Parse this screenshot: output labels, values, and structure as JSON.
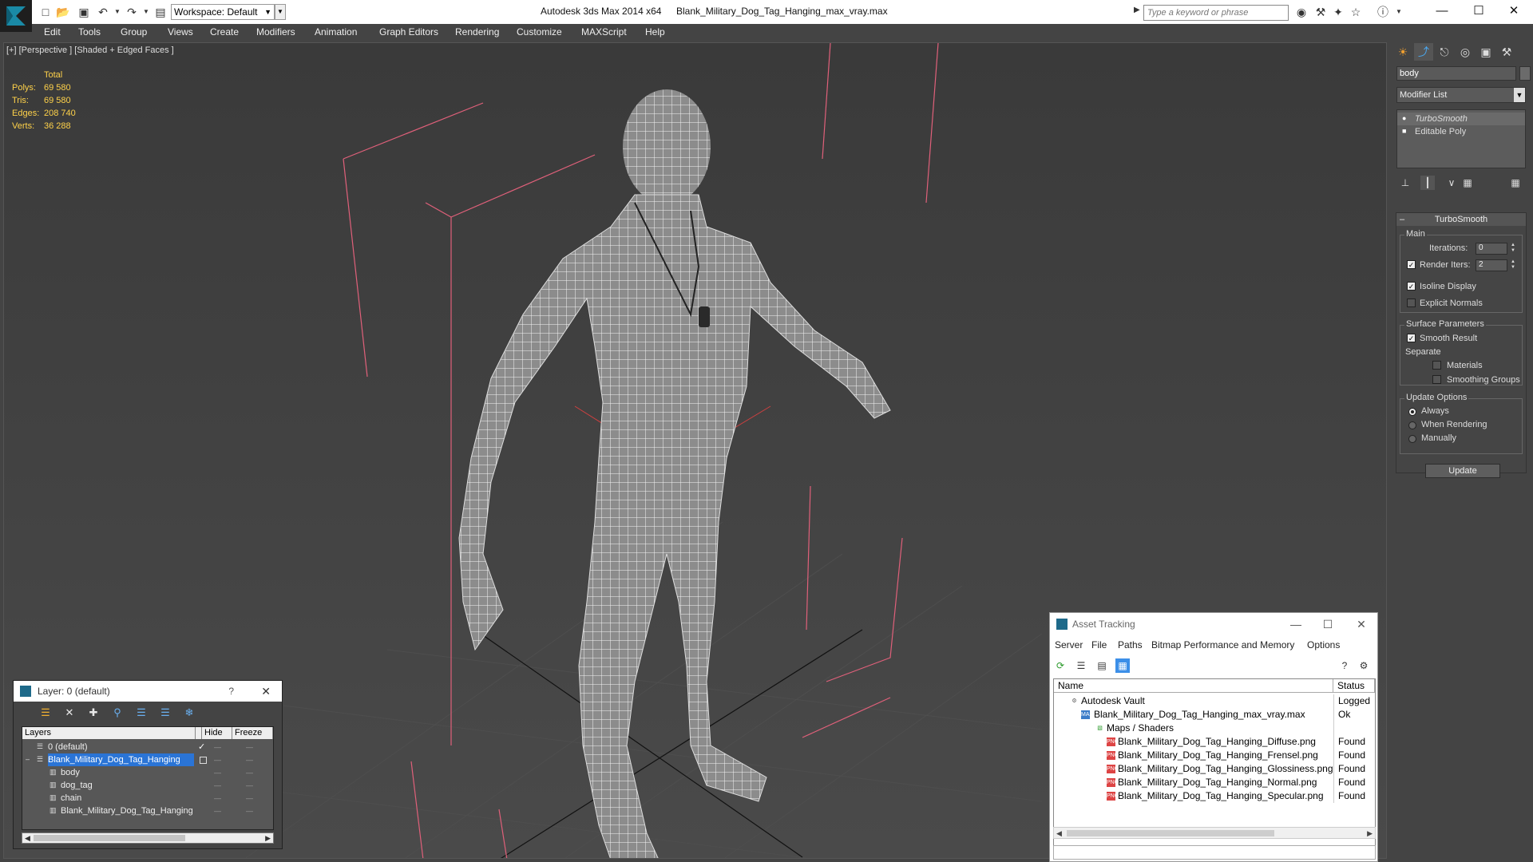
{
  "titlebar": {
    "workspace": "Workspace: Default",
    "app_title": "Autodesk 3ds Max  2014 x64",
    "file_title": "Blank_Military_Dog_Tag_Hanging_max_vray.max",
    "search_placeholder": "Type a keyword or phrase"
  },
  "menu": [
    "Edit",
    "Tools",
    "Group",
    "Views",
    "Create",
    "Modifiers",
    "Animation",
    "Graph Editors",
    "Rendering",
    "Customize",
    "MAXScript",
    "Help"
  ],
  "viewport": {
    "label": "[+] [Perspective ] [Shaded + Edged Faces ]",
    "stats_header": "Total",
    "stats": [
      {
        "label": "Polys:",
        "value": "69 580"
      },
      {
        "label": "Tris:",
        "value": "69 580"
      },
      {
        "label": "Edges:",
        "value": "208 740"
      },
      {
        "label": "Verts:",
        "value": "36 288"
      }
    ]
  },
  "command_panel": {
    "object_name": "body",
    "modifier_list": "Modifier List",
    "stack": [
      "TurboSmooth",
      "Editable Poly"
    ],
    "rollout_title": "TurboSmooth",
    "main_group": "Main",
    "iterations_label": "Iterations:",
    "iterations_value": "0",
    "render_iters_label": "Render Iters:",
    "render_iters_value": "2",
    "isoline_display": "Isoline Display",
    "explicit_normals": "Explicit Normals",
    "surface_group": "Surface Parameters",
    "smooth_result": "Smooth Result",
    "separate": "Separate",
    "materials": "Materials",
    "smoothing_groups": "Smoothing Groups",
    "update_group": "Update Options",
    "always": "Always",
    "when_rendering": "When Rendering",
    "manually": "Manually",
    "update_button": "Update"
  },
  "layer_dialog": {
    "title": "Layer: 0 (default)",
    "help": "?",
    "col_layers": "Layers",
    "col_hide": "Hide",
    "col_freeze": "Freeze",
    "rows": [
      "0 (default)",
      "Blank_Military_Dog_Tag_Hanging",
      "body",
      "dog_tag",
      "chain",
      "Blank_Military_Dog_Tag_Hanging"
    ]
  },
  "asset_dialog": {
    "title": "Asset Tracking",
    "menu": [
      "Server",
      "File",
      "Paths",
      "Bitmap Performance and Memory",
      "Options"
    ],
    "col_name": "Name",
    "col_status": "Status",
    "rows": [
      {
        "name": "Autodesk Vault",
        "status": "Logged"
      },
      {
        "name": "Blank_Military_Dog_Tag_Hanging_max_vray.max",
        "status": "Ok"
      },
      {
        "name": "Maps / Shaders",
        "status": ""
      },
      {
        "name": "Blank_Military_Dog_Tag_Hanging_Diffuse.png",
        "status": "Found"
      },
      {
        "name": "Blank_Military_Dog_Tag_Hanging_Frensel.png",
        "status": "Found"
      },
      {
        "name": "Blank_Military_Dog_Tag_Hanging_Glossiness.png",
        "status": "Found"
      },
      {
        "name": "Blank_Military_Dog_Tag_Hanging_Normal.png",
        "status": "Found"
      },
      {
        "name": "Blank_Military_Dog_Tag_Hanging_Specular.png",
        "status": "Found"
      }
    ]
  },
  "colors": {
    "accent": "#2a74d6",
    "stats": "#ffd24a",
    "frame": "#e0607a"
  }
}
